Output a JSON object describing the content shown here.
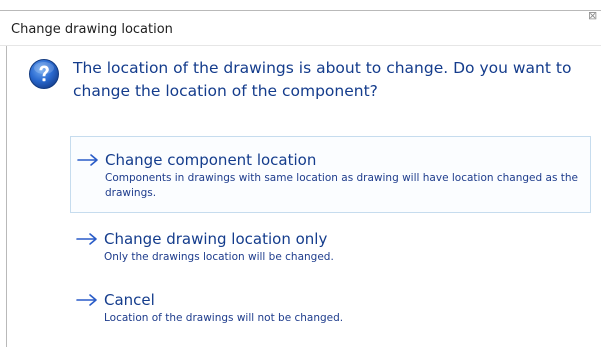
{
  "window": {
    "title": "Change drawing location",
    "close_glyph": "⊠"
  },
  "icons": {
    "header": "question-icon",
    "command": "arrow-right-icon"
  },
  "colors": {
    "instruction_text": "#143c8c",
    "link_text": "#143c8c",
    "focus_border": "#c6dcee",
    "icon_blue": "#2a6ad0"
  },
  "message": {
    "main_instruction": "The location of the drawings is about to change. Do you want to change the location of the component?"
  },
  "commands": [
    {
      "label": "Change component location",
      "note": "Components in drawings with same location as drawing will have location changed as the drawings."
    },
    {
      "label": "Change drawing location only",
      "note": "Only the drawings location will be changed."
    },
    {
      "label": "Cancel",
      "note": "Location of the drawings will not be changed."
    }
  ]
}
